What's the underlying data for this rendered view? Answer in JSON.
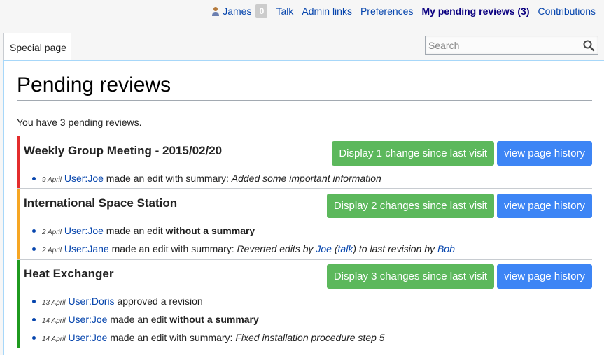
{
  "personal": {
    "username": "James",
    "notifications": "0",
    "links": [
      "Talk",
      "Admin links",
      "Preferences"
    ],
    "active_link": "My pending reviews (3)",
    "last_link": "Contributions"
  },
  "tab": {
    "label": "Special page"
  },
  "search": {
    "placeholder": "Search"
  },
  "page": {
    "title": "Pending reviews",
    "intro": "You have 3 pending reviews."
  },
  "colors": {
    "red": "#e32d2d",
    "orange": "#f6a623",
    "green": "#1f9a1f",
    "button_green": "#5cb85c",
    "button_blue": "#3d85f5"
  },
  "reviews": [
    {
      "title": "Weekly Group Meeting - 2015/02/20",
      "status_color": "red",
      "display_label": "Display 1 change since last visit",
      "history_label": "view page history",
      "edits": [
        {
          "date": "9 April",
          "user": "User:Joe",
          "text": "made an edit with summary:",
          "summary": "Added some important information"
        }
      ]
    },
    {
      "title": "International Space Station",
      "status_color": "orange",
      "display_label": "Display 2 changes since last visit",
      "history_label": "view page history",
      "edits": [
        {
          "date": "2 April",
          "user": "User:Joe",
          "text": "made an edit",
          "bold": "without a summary"
        },
        {
          "date": "2 April",
          "user": "User:Jane",
          "text": "made an edit with summary:",
          "summary_pre": "Reverted edits by",
          "summary_user": "Joe",
          "summary_talk": "talk",
          "summary_post": "to last revision by",
          "summary_last": "Bob"
        }
      ]
    },
    {
      "title": "Heat Exchanger",
      "status_color": "green",
      "display_label": "Display 3 changes since last visit",
      "history_label": "view page history",
      "edits": [
        {
          "date": "13 April",
          "user": "User:Doris",
          "text": "approved a revision"
        },
        {
          "date": "14 April",
          "user": "User:Joe",
          "text": "made an edit",
          "bold": "without a summary"
        },
        {
          "date": "14 April",
          "user": "User:Joe",
          "text": "made an edit with summary:",
          "summary": "Fixed installation procedure step 5"
        }
      ]
    }
  ]
}
